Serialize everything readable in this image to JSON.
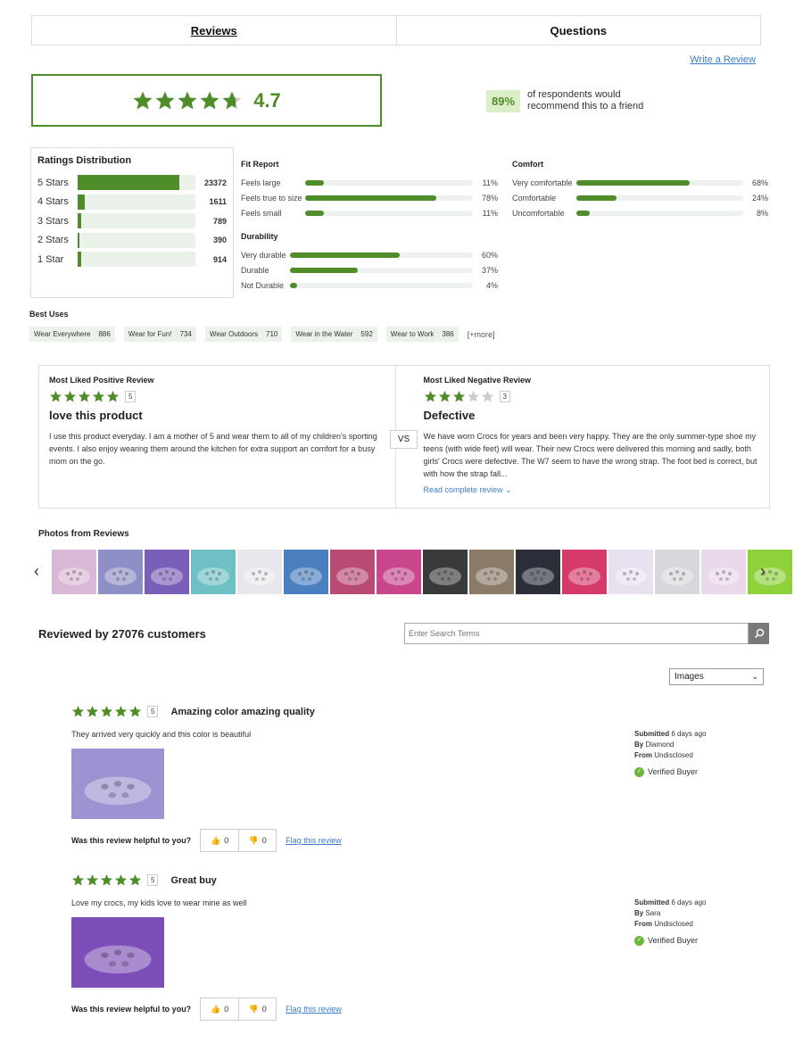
{
  "tabs": [
    {
      "label": "Reviews",
      "active": true
    },
    {
      "label": "Questions",
      "active": false
    }
  ],
  "write_review": "Write a Review",
  "overall": {
    "rating": "4.7",
    "stars": 4.7,
    "accent": "#4e8d2a"
  },
  "recommend": {
    "pct": "89%",
    "text": "of respondents would recommend this to a friend"
  },
  "distribution": {
    "title": "Ratings Distribution",
    "rows": [
      {
        "label": "5 Stars",
        "count": "23372",
        "fraction": 0.86
      },
      {
        "label": "4 Stars",
        "count": "1611",
        "fraction": 0.06
      },
      {
        "label": "3 Stars",
        "count": "789",
        "fraction": 0.03
      },
      {
        "label": "2 Stars",
        "count": "390",
        "fraction": 0.015
      },
      {
        "label": "1 Star",
        "count": "914",
        "fraction": 0.035
      }
    ]
  },
  "fit_report": {
    "title": "Fit Report",
    "rows": [
      {
        "label": "Feels large",
        "pct": "11%",
        "value": 11
      },
      {
        "label": "Feels true to size",
        "pct": "78%",
        "value": 78
      },
      {
        "label": "Feels small",
        "pct": "11%",
        "value": 11
      }
    ]
  },
  "durability": {
    "title": "Durability",
    "rows": [
      {
        "label": "Very durable",
        "pct": "60%",
        "value": 60
      },
      {
        "label": "Durable",
        "pct": "37%",
        "value": 37
      },
      {
        "label": "Not Durable",
        "pct": "4%",
        "value": 4
      }
    ]
  },
  "comfort": {
    "title": "Comfort",
    "rows": [
      {
        "label": "Very comfortable",
        "pct": "68%",
        "value": 68
      },
      {
        "label": "Comfortable",
        "pct": "24%",
        "value": 24
      },
      {
        "label": "Uncomfortable",
        "pct": "8%",
        "value": 8
      }
    ]
  },
  "best_uses": {
    "title": "Best Uses",
    "tags": [
      {
        "label": "Wear Everywhere",
        "count": "886"
      },
      {
        "label": "Wear for Fun!",
        "count": "734"
      },
      {
        "label": "Wear Outdoors",
        "count": "710"
      },
      {
        "label": "Wear in the Water",
        "count": "592"
      },
      {
        "label": "Wear to Work",
        "count": "386"
      }
    ],
    "more": "[+more]"
  },
  "most_liked": {
    "positive": {
      "heading": "Most Liked Positive Review",
      "stars": 5,
      "count": "5",
      "title": "love this product",
      "body": "I use this product everyday. I am a mother of 5 and wear them to all of my children's sporting events. I also enjoy wearing them around the kitchen for extra support an comfort for a busy mom on the go."
    },
    "vs": "VS",
    "negative": {
      "heading": "Most Liked Negative Review",
      "stars": 3,
      "count": "3",
      "title": "Defective",
      "body": "We have worn Crocs for years and been very happy. They are the only summer-type shoe my teens (with wide feet) will wear. Their new Crocs were delivered this morning and sadly, both girls' Crocs were defective. The W7 seem to have the wrong strap. The foot bed is correct, but with how the strap fall...",
      "read_more": "Read complete review"
    }
  },
  "photos": {
    "title": "Photos from Reviews",
    "colors": [
      "#d9b7d6",
      "#8f8fc7",
      "#7a5fb8",
      "#6fc0c5",
      "#e8e8ec",
      "#4b7fbf",
      "#b84a74",
      "#c9468c",
      "#3a3a3a",
      "#8a7a68",
      "#2b2f3a",
      "#d63a6a",
      "#e8e0ee",
      "#d8d8dc",
      "#e9d8ea",
      "#8fd13a"
    ]
  },
  "reviewed_by": "Reviewed by 27076 customers",
  "search_placeholder": "Enter Search Terms",
  "sort": "Images",
  "reviews": [
    {
      "stars": 5,
      "count": "5",
      "title": "Amazing color amazing quality",
      "text": "They arrived very quickly and this color is beautiful",
      "submitted_label": "Submitted",
      "submitted": "6 days ago",
      "by_label": "By",
      "by": "Diamond",
      "from_label": "From",
      "from": "Undisclosed",
      "verified": "Verified Buyer",
      "photo_color": "#9b93d2",
      "helpful_q": "Was this review helpful to you?",
      "up": "0",
      "down": "0",
      "flag": "Flag this review"
    },
    {
      "stars": 5,
      "count": "5",
      "title": "Great buy",
      "text": "Love my crocs, my kids love to wear mine as well",
      "submitted_label": "Submitted",
      "submitted": "6 days ago",
      "by_label": "By",
      "by": "Sara",
      "from_label": "From",
      "from": "Undisclosed",
      "verified": "Verified Buyer",
      "photo_color": "#7b4fb7",
      "helpful_q": "Was this review helpful to you?",
      "up": "0",
      "down": "0",
      "flag": "Flag this review"
    }
  ]
}
